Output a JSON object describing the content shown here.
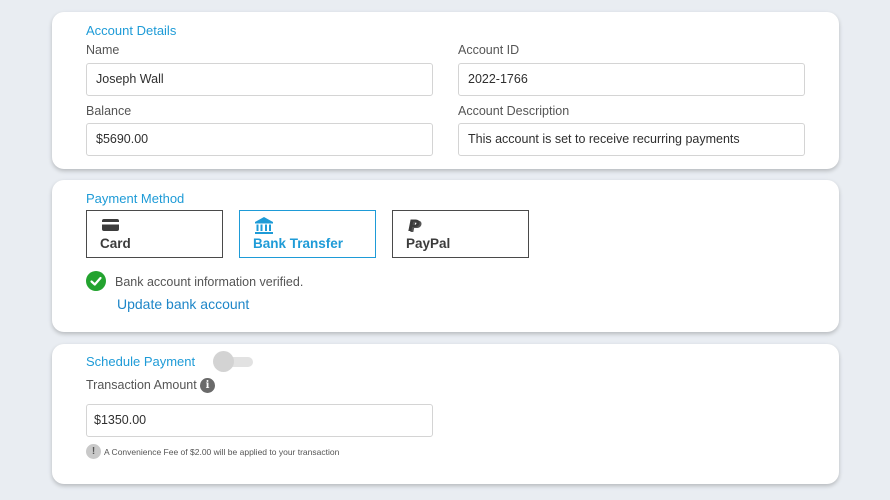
{
  "account_details": {
    "title": "Account Details",
    "name_label": "Name",
    "name_value": "Joseph Wall",
    "account_id_label": "Account ID",
    "account_id_value": "2022-1766",
    "balance_label": "Balance",
    "balance_value": "$5690.00",
    "description_label": "Account Description",
    "description_value": "This account is set to receive recurring payments"
  },
  "payment_method": {
    "title": "Payment Method",
    "options": [
      {
        "label": "Card",
        "icon": "credit-card-icon",
        "selected": false
      },
      {
        "label": "Bank Transfer",
        "icon": "bank-icon",
        "selected": true
      },
      {
        "label": "PayPal",
        "icon": "paypal-icon",
        "selected": false
      }
    ],
    "verified_text": "Bank account information verified.",
    "update_link": "Update bank account"
  },
  "schedule": {
    "title": "Schedule Payment",
    "toggle_on": false,
    "amount_label": "Transaction Amount",
    "amount_value": "$1350.00",
    "fee_note": "A Convenience Fee of $2.00 will be applied to your transaction"
  },
  "colors": {
    "accent": "#1e9bd7",
    "link": "#1e86c8",
    "success": "#23a32f",
    "background": "#e9edf2"
  }
}
